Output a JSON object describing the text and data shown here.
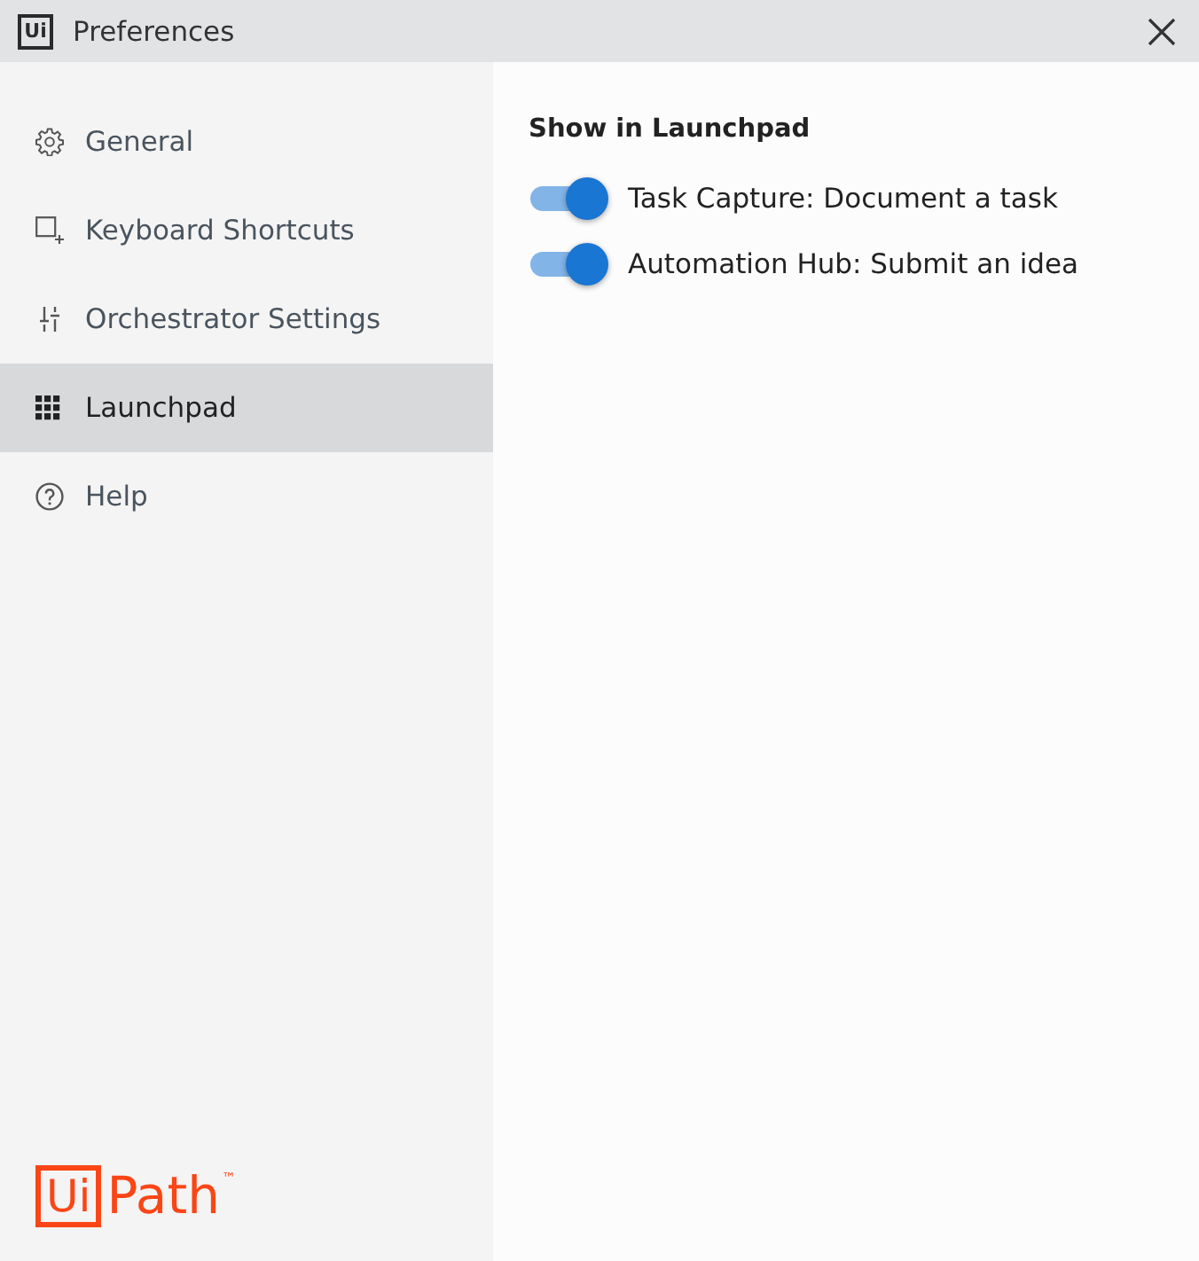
{
  "window": {
    "app_icon": "Ui",
    "title": "Preferences"
  },
  "sidebar": {
    "items": [
      {
        "label": "General",
        "selected": false
      },
      {
        "label": "Keyboard Shortcuts",
        "selected": false
      },
      {
        "label": "Orchestrator Settings",
        "selected": false
      },
      {
        "label": "Launchpad",
        "selected": true
      },
      {
        "label": "Help",
        "selected": false
      }
    ],
    "logo": {
      "boxed": "Ui",
      "text": "Path",
      "mark": "™"
    }
  },
  "content": {
    "heading": "Show in Launchpad",
    "toggles": [
      {
        "label": "Task Capture: Document a task",
        "on": true
      },
      {
        "label": "Automation Hub: Submit an idea",
        "on": true
      }
    ]
  }
}
